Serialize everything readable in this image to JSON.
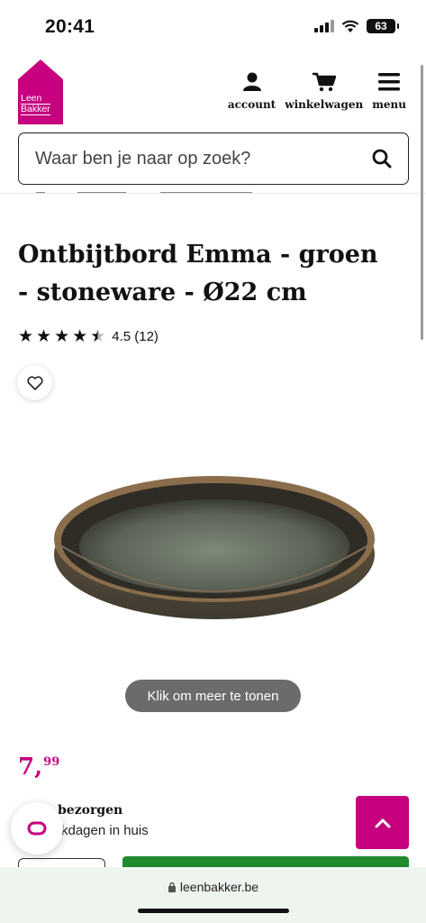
{
  "status": {
    "time": "20:41",
    "battery": "63"
  },
  "header": {
    "logo_line1": "Leen",
    "logo_line2": "Bakker",
    "nav": [
      {
        "label": "account",
        "icon": "user-icon"
      },
      {
        "label": "winkelwagen",
        "icon": "cart-icon"
      },
      {
        "label": "menu",
        "icon": "hamburger-icon"
      }
    ]
  },
  "search": {
    "placeholder": "Waar ben je naar op zoek?"
  },
  "product": {
    "title": "Ontbijtbord Emma - groen - stoneware - Ø22 cm",
    "rating": 4.5,
    "rating_text": "4.5 (12)",
    "more_label": "Klik om meer te tonen",
    "price_int": "7,",
    "price_dec": "99",
    "delivery_title": "bezorgen",
    "delivery_sub": "rkdagen in huis"
  },
  "browser": {
    "url": "leenbakker.be"
  },
  "colors": {
    "brand": "#c6007e",
    "cart_green": "#1f8a2e"
  }
}
